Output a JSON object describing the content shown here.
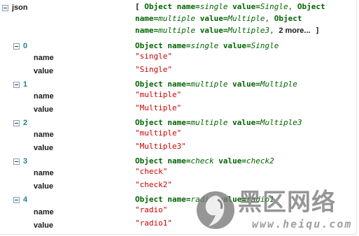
{
  "root": {
    "key": "json",
    "summary": {
      "open": "[",
      "close": "]",
      "obj_word": "Object",
      "name_word": "name=",
      "value_word": "value=",
      "items": [
        {
          "name": "single",
          "value": "Single"
        },
        {
          "name": "multiple",
          "value": "Multiple"
        },
        {
          "name": "multiple",
          "value": "Multiple3"
        }
      ],
      "more": "2 more..."
    }
  },
  "entries": [
    {
      "index": "0",
      "obj_name": "single",
      "obj_value": "Single",
      "name_label": "name",
      "value_label": "value",
      "name_str": "\"single\"",
      "value_str": "\"Single\""
    },
    {
      "index": "1",
      "obj_name": "multiple",
      "obj_value": "Multiple",
      "name_label": "name",
      "value_label": "value",
      "name_str": "\"multiple\"",
      "value_str": "\"Multiple\""
    },
    {
      "index": "2",
      "obj_name": "multiple",
      "obj_value": "Multiple3",
      "name_label": "name",
      "value_label": "value",
      "name_str": "\"multiple\"",
      "value_str": "\"Multiple3\""
    },
    {
      "index": "3",
      "obj_name": "check",
      "obj_value": "check2",
      "name_label": "name",
      "value_label": "value",
      "name_str": "\"check\"",
      "value_str": "\"check2\""
    },
    {
      "index": "4",
      "obj_name": "radio",
      "obj_value": "radio1",
      "name_label": "name",
      "value_label": "value",
      "name_str": "\"radio\"",
      "value_str": "\"radio1\""
    }
  ],
  "watermark": {
    "text": "黑区网络",
    "url": "www.heiqu.com"
  },
  "colors": {
    "object_green": "#006400",
    "string_red": "#cc0000",
    "index_blue": "#1f7f9b"
  }
}
